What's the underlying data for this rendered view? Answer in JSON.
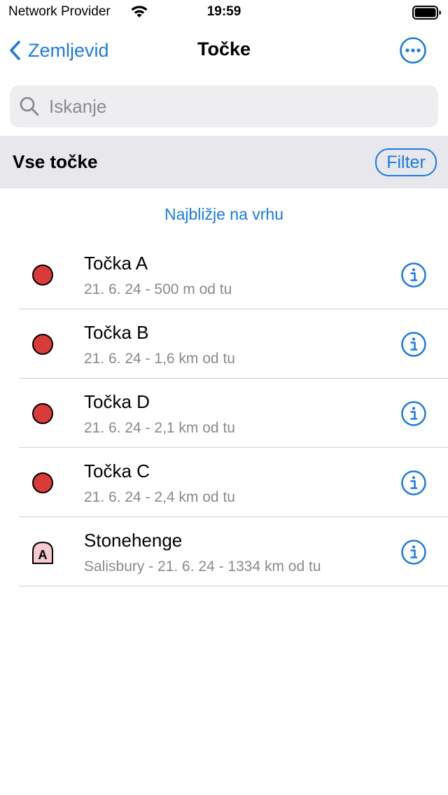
{
  "status_bar": {
    "carrier": "Network Provider",
    "time": "19:59"
  },
  "nav": {
    "back_label": "Zemljevid",
    "title": "Točke",
    "more_icon": "ellipsis-circle-icon"
  },
  "search": {
    "placeholder": "Iskanje",
    "value": ""
  },
  "section": {
    "title": "Vse točke",
    "filter_label": "Filter"
  },
  "sort_label": "Najbližje na vrhu",
  "points": [
    {
      "name": "Točka A",
      "detail": "21. 6. 24 - 500 m od tu",
      "marker": "red-dot-icon"
    },
    {
      "name": "Točka B",
      "detail": "21. 6. 24 - 1,6 km od tu",
      "marker": "red-dot-icon"
    },
    {
      "name": "Točka D",
      "detail": "21. 6. 24 - 2,1 km od tu",
      "marker": "red-dot-icon"
    },
    {
      "name": "Točka C",
      "detail": "21. 6. 24 - 2,4 km od tu",
      "marker": "red-dot-icon"
    },
    {
      "name": "Stonehenge",
      "detail": "Salisbury - 21. 6. 24 - 1334 km od tu",
      "marker": "tombstone-a-icon",
      "marker_letter": "A"
    }
  ],
  "colors": {
    "accent": "#1a7ae6",
    "marker_red": "#d93a3a",
    "marker_pink": "#f8c9d0",
    "section_bg": "#e7e7ec",
    "search_bg": "#eeeef0",
    "secondary_text": "#8a8a8e"
  }
}
